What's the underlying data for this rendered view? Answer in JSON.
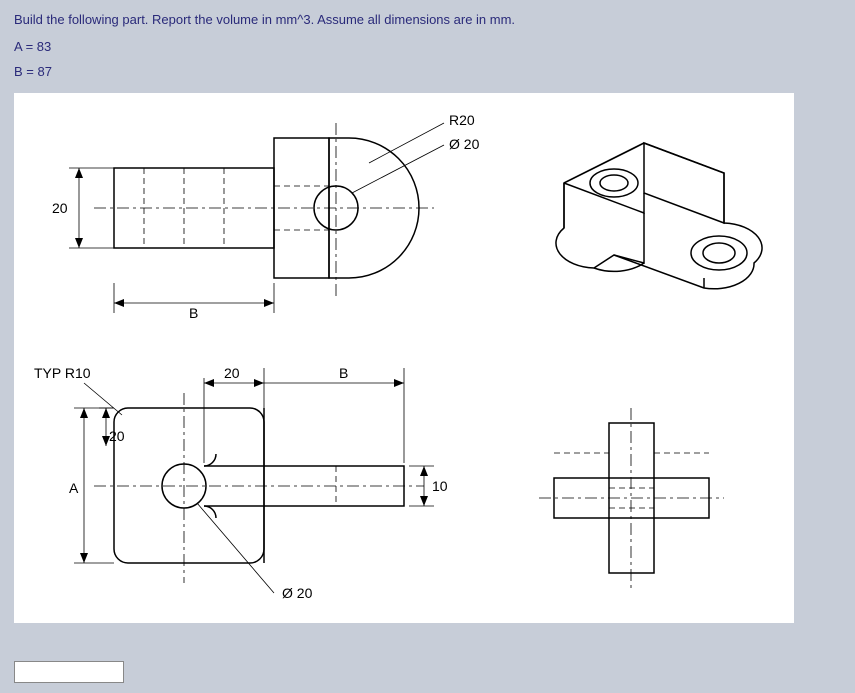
{
  "question": "Build the following part. Report the volume in mm^3. Assume all dimensions are in mm.",
  "params": {
    "A_label": "A = 83",
    "B_label": "B = 87"
  },
  "dims": {
    "twenty_top": "20",
    "B_top": "B",
    "R20": "R20",
    "dia20_top": "Ø 20",
    "TYP_R10": "TYP R10",
    "twenty_mid": "20",
    "B_mid": "B",
    "twenty_v": "20",
    "A_v": "A",
    "ten": "10",
    "dia20_bottom": "Ø 20"
  },
  "answer": ""
}
